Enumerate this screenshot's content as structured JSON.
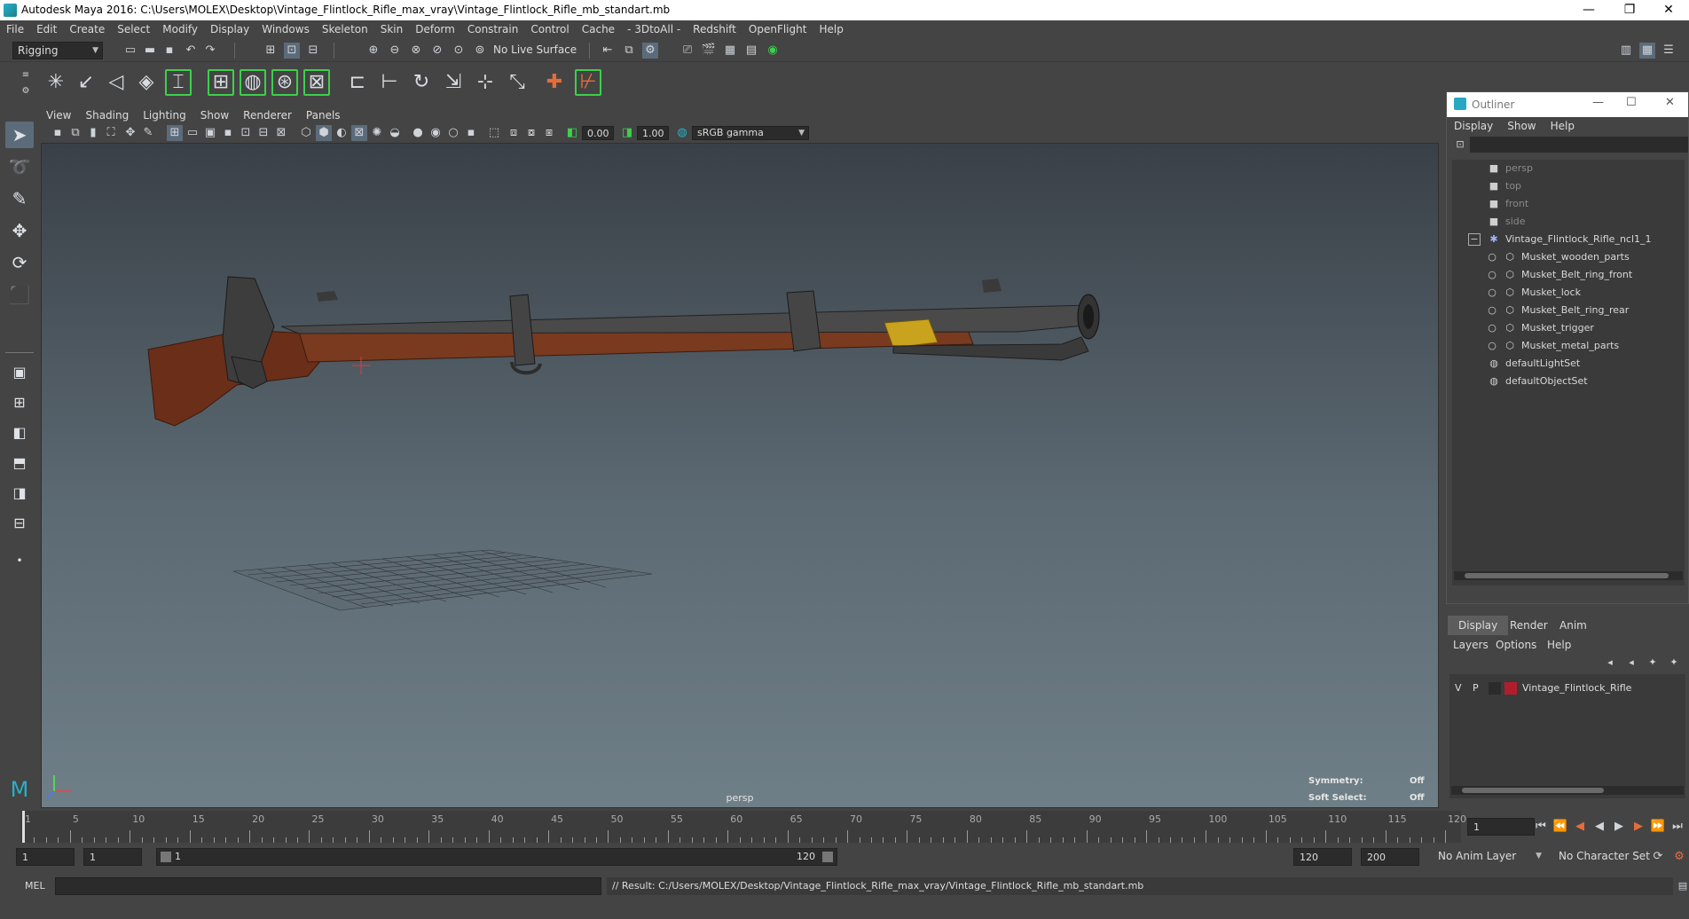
{
  "app": {
    "title": "Autodesk Maya 2016: C:\\Users\\MOLEX\\Desktop\\Vintage_Flintlock_Rifle_max_vray\\Vintage_Flintlock_Rifle_mb_standart.mb",
    "window_buttons": {
      "minimize": "—",
      "restore": "❐",
      "close": "✕"
    }
  },
  "menubar": [
    "File",
    "Edit",
    "Create",
    "Select",
    "Modify",
    "Display",
    "Windows",
    "Skeleton",
    "Skin",
    "Deform",
    "Constrain",
    "Control",
    "Cache",
    "- 3DtoAll -",
    "Redshift",
    "OpenFlight",
    "Help"
  ],
  "statusline": {
    "menuset": "Rigging",
    "live_surface": "No Live Surface"
  },
  "panel": {
    "menus": [
      "View",
      "Shading",
      "Lighting",
      "Show",
      "Renderer",
      "Panels"
    ],
    "exposure": "0.00",
    "gamma": "1.00",
    "color_space": "sRGB gamma",
    "camera_label": "persp",
    "hud": {
      "symmetry_label": "Symmetry:",
      "symmetry_value": "Off",
      "soft_select_label": "Soft Select:",
      "soft_select_value": "Off"
    }
  },
  "outliner": {
    "title": "Outliner",
    "menus": [
      "Display",
      "Show",
      "Help"
    ],
    "cameras": [
      "persp",
      "top",
      "front",
      "side"
    ],
    "group": {
      "name": "Vintage_Flintlock_Rifle_ncl1_1",
      "children": [
        "Musket_wooden_parts",
        "Musket_Belt_ring_front",
        "Musket_lock",
        "Musket_Belt_ring_rear",
        "Musket_trigger",
        "Musket_metal_parts"
      ]
    },
    "sets": [
      "defaultLightSet",
      "defaultObjectSet"
    ]
  },
  "layers": {
    "tabs": [
      "Display",
      "Render",
      "Anim"
    ],
    "active_tab": "Display",
    "menus": [
      "Layers",
      "Options",
      "Help"
    ],
    "layer": {
      "v": "V",
      "p": "P",
      "name": "Vintage_Flintlock_Rifle",
      "color": "#b01e2e"
    }
  },
  "timeline": {
    "ticks": [
      "1",
      "5",
      "10",
      "15",
      "20",
      "25",
      "30",
      "35",
      "40",
      "45",
      "50",
      "55",
      "60",
      "65",
      "70",
      "75",
      "80",
      "85",
      "90",
      "95",
      "100",
      "105",
      "110",
      "115",
      "120"
    ],
    "current_frame": "1",
    "playback_glyphs": {
      "to_start": "⏮",
      "step_back_key": "⏪",
      "step_back": "◀",
      "play_back": "◀",
      "play_forward": "▶",
      "step_forward": "▶",
      "step_forward_key": "⏩",
      "to_end": "⏭"
    }
  },
  "range": {
    "start": "1",
    "playback_start": "1",
    "slider_start": "1",
    "slider_end": "120",
    "playback_end": "120",
    "end": "200",
    "anim_layer": "No Anim Layer",
    "character_set": "No Character Set"
  },
  "cmdline": {
    "language": "MEL",
    "result": "// Result: C:/Users/MOLEX/Desktop/Vintage_Flintlock_Rifle_max_vray/Vintage_Flintlock_Rifle_mb_standart.mb"
  },
  "colors": {
    "accent": "#29b0c7",
    "highlight_green": "#3bd14a",
    "wood": "#6b2e18",
    "metal": "#3a3a3a",
    "brass": "#c9a21e"
  },
  "icons": {
    "select": "select-tool-icon",
    "lasso": "lasso-tool-icon",
    "paint": "paint-select-icon",
    "move": "move-tool-icon",
    "rotate": "rotate-tool-icon",
    "scale": "scale-tool-icon"
  }
}
